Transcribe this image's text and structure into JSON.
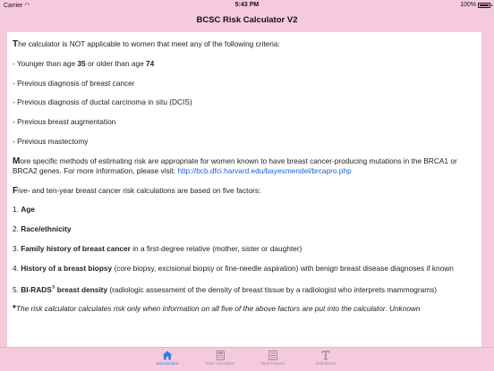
{
  "status_bar": {
    "carrier": "Carrier",
    "time": "5:43 PM",
    "battery": "100%"
  },
  "nav": {
    "title": "BCSC Risk Calculator V2"
  },
  "content": {
    "intro": {
      "drop": "T",
      "rest": "he calculator is NOT applicable to women that meet any of the following criteria:"
    },
    "age": {
      "pre": "- Younger than age ",
      "low": "35",
      "mid": " or older than age ",
      "high": "74"
    },
    "criteria": [
      "- Previous diagnosis of breast cancer",
      "- Previous diagnosis of ductal carcinoma in situ (DCIS)",
      "- Previous breast augmentation",
      "- Previous mastectomy"
    ],
    "specific": {
      "drop": "M",
      "rest": "ore specific methods of estimating risk are appropriate for women known to have breast cancer-producing mutations in the BRCA1 or BRCA2 genes. For more information, please visit: ",
      "link": "http://bcb.dfci.harvard.edu/bayesmendel/brcapro.php"
    },
    "five": {
      "drop": "F",
      "rest": "ive- and ten-year breast cancer risk calculations are based on five factors:"
    },
    "factors": [
      {
        "num": "1. ",
        "bold": "Age",
        "rest": ""
      },
      {
        "num": "2. ",
        "bold": "Race/ethnicity",
        "rest": ""
      },
      {
        "num": "3. ",
        "bold": "Family history of breast cancer",
        "rest": " in a first-degree relative (mother, sister or daughter)"
      },
      {
        "num": "4. ",
        "bold": "History of a breast biopsy",
        "rest": " (core biopsy, excisional biopsy or fine-needle aspiration) with benign breast disease diagnoses if known"
      }
    ],
    "birads": {
      "num": "5. ",
      "bold": "BI-RADS",
      "reg": "®",
      "bold2": " breast density",
      "rest": " (radiologic assessment of the density of breast tissue by a radiologist who interprets mammograms)"
    },
    "note": {
      "star": "*",
      "text": "The risk calculator calculates risk only when information on all five of the above factors are put into the calculator. Unknown"
    }
  },
  "tabs": [
    {
      "label": "Introduction",
      "icon": "home-icon",
      "active": true
    },
    {
      "label": "Risk Calculator",
      "icon": "calculator-icon",
      "active": false
    },
    {
      "label": "Risk Factors",
      "icon": "risk-factors-icon",
      "active": false
    },
    {
      "label": "Definitions",
      "icon": "definitions-icon",
      "active": false
    }
  ],
  "colors": {
    "accent": "#2f7fe6",
    "background": "#f7c9dc",
    "link": "#1a5fd0"
  }
}
